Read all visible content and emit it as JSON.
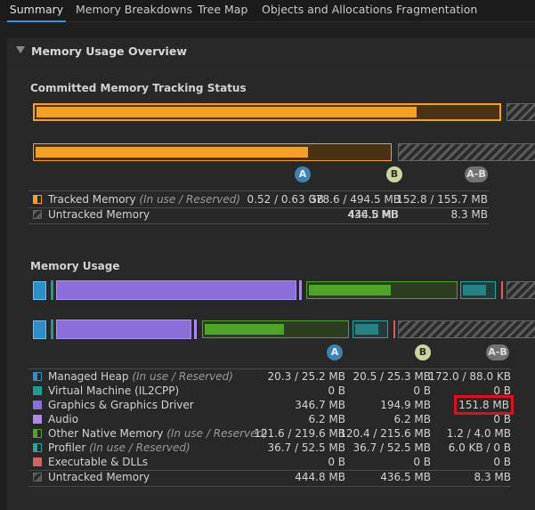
{
  "tabs": [
    {
      "label": "Summary",
      "active": true
    },
    {
      "label": "Memory Breakdowns",
      "active": false
    },
    {
      "label": "Tree Map",
      "active": false
    },
    {
      "label": "Objects and Allocations",
      "active": false
    },
    {
      "label": "Fragmentation",
      "active": false
    }
  ],
  "overview": {
    "title": "Memory Usage Overview",
    "tracking": {
      "title": "Committed Memory Tracking Status",
      "markers": {
        "a": "A",
        "b": "B",
        "ab": "A-B"
      },
      "rows": [
        {
          "name": "Tracked Memory",
          "note": "(In use / Reserved)",
          "a": "0.52 / 0.63 GB",
          "b": "378.6 / 494.5 MB",
          "diff": "152.8 / 155.7 MB"
        },
        {
          "name": "Untracked Memory",
          "note": "",
          "a": "444.8 MB",
          "b": "436.5 MB",
          "diff": "8.3 MB"
        }
      ]
    },
    "usage": {
      "title": "Memory Usage",
      "markers": {
        "a": "A",
        "b": "B",
        "ab": "A-B"
      },
      "rows": [
        {
          "name": "Managed Heap",
          "note": "(In use / Reserved)",
          "a": "20.3 / 25.2 MB",
          "b": "20.5 / 25.3 MB",
          "diff": "172.0 / 88.0 KB"
        },
        {
          "name": "Virtual Machine (IL2CPP)",
          "note": "",
          "a": "0 B",
          "b": "0 B",
          "diff": "0 B"
        },
        {
          "name": "Graphics & Graphics Driver",
          "note": "",
          "a": "346.7 MB",
          "b": "194.9 MB",
          "diff": "151.8 MB"
        },
        {
          "name": "Audio",
          "note": "",
          "a": "6.2 MB",
          "b": "6.2 MB",
          "diff": "0 B"
        },
        {
          "name": "Other Native Memory",
          "note": "(In use / Reserved)",
          "a": "121.6 / 219.6 MB",
          "b": "120.4 / 215.6 MB",
          "diff": "1.2 / 4.0 MB"
        },
        {
          "name": "Profiler",
          "note": "(In use / Reserved)",
          "a": "36.7 / 52.5 MB",
          "b": "36.7 / 52.5 MB",
          "diff": "6.0 KB / 0 B"
        },
        {
          "name": "Executable & DLLs",
          "note": "",
          "a": "0 B",
          "b": "0 B",
          "diff": "0 B"
        },
        {
          "name": "Untracked Memory",
          "note": "",
          "a": "444.8 MB",
          "b": "436.5 MB",
          "diff": "8.3 MB"
        }
      ]
    }
  },
  "colors": {
    "tracked": "#f5a020",
    "managed": "#2b8fc9",
    "vm": "#1c9c93",
    "graphics": "#8a6fdb",
    "audio": "#b089e0",
    "other_native": "#4fa52a",
    "profiler": "#27a3a3",
    "executable": "#d06464",
    "untracked": "#777777"
  }
}
